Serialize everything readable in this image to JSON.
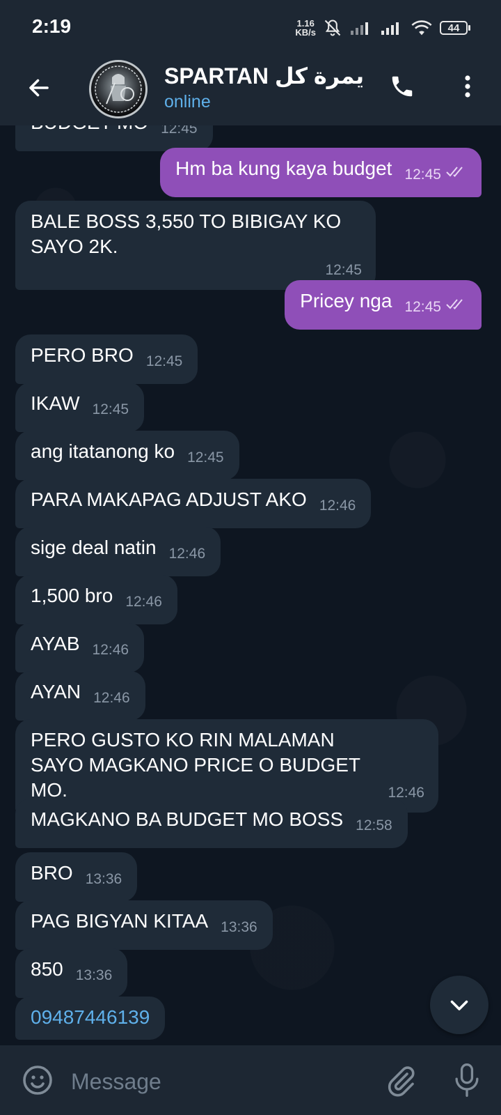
{
  "status_bar": {
    "time": "2:19",
    "net_speed_value": "1.16",
    "net_speed_unit": "KB/s",
    "battery": "44"
  },
  "header": {
    "title": "SPARTAN يمرة كل",
    "status": "online"
  },
  "messages": [
    {
      "dir": "in",
      "text": "BUDGET MO",
      "time": "12:45"
    },
    {
      "dir": "out",
      "text": "Hm ba kung kaya budget",
      "time": "12:45"
    },
    {
      "dir": "in",
      "text": "BALE BOSS 3,550 TO BIBIGAY KO SAYO 2K.",
      "time": "12:45"
    },
    {
      "dir": "out",
      "text": "Pricey nga",
      "time": "12:45"
    },
    {
      "dir": "in",
      "text": "PERO BRO",
      "time": "12:45"
    },
    {
      "dir": "in",
      "text": "IKAW",
      "time": "12:45"
    },
    {
      "dir": "in",
      "text": "ang itatanong ko",
      "time": "12:45"
    },
    {
      "dir": "in",
      "text": "PARA MAKAPAG ADJUST AKO",
      "time": "12:46"
    },
    {
      "dir": "in",
      "text": "sige deal natin",
      "time": "12:46"
    },
    {
      "dir": "in",
      "text": "1,500 bro",
      "time": "12:46"
    },
    {
      "dir": "in",
      "text": "AYAB",
      "time": "12:46"
    },
    {
      "dir": "in",
      "text": "AYAN",
      "time": "12:46"
    },
    {
      "dir": "in",
      "text": "PERO GUSTO KO RIN MALAMAN SAYO MAGKANO PRICE O BUDGET MO.",
      "time": "12:46"
    },
    {
      "dir": "in",
      "text": "MAGKANO BA BUDGET MO BOSS",
      "time": "12:58"
    },
    {
      "dir": "in",
      "text": "BRO",
      "time": "13:36"
    },
    {
      "dir": "in",
      "text": "PAG BIGYAN KITAA",
      "time": "13:36"
    },
    {
      "dir": "in",
      "text": "850",
      "time": "13:36"
    },
    {
      "dir": "in",
      "text": "09487446139",
      "time": ""
    }
  ],
  "composer": {
    "placeholder": "Message"
  },
  "colors": {
    "background": "#0e1621",
    "header": "#1d2733",
    "incoming_bubble": "#1f2b38",
    "outgoing_bubble": "#8f4fb8",
    "accent": "#5fb0ea"
  },
  "icons": [
    "back-arrow-icon",
    "phone-icon",
    "more-vertical-icon",
    "chevron-down-icon",
    "emoji-icon",
    "paperclip-icon",
    "microphone-icon",
    "double-check-icon"
  ]
}
